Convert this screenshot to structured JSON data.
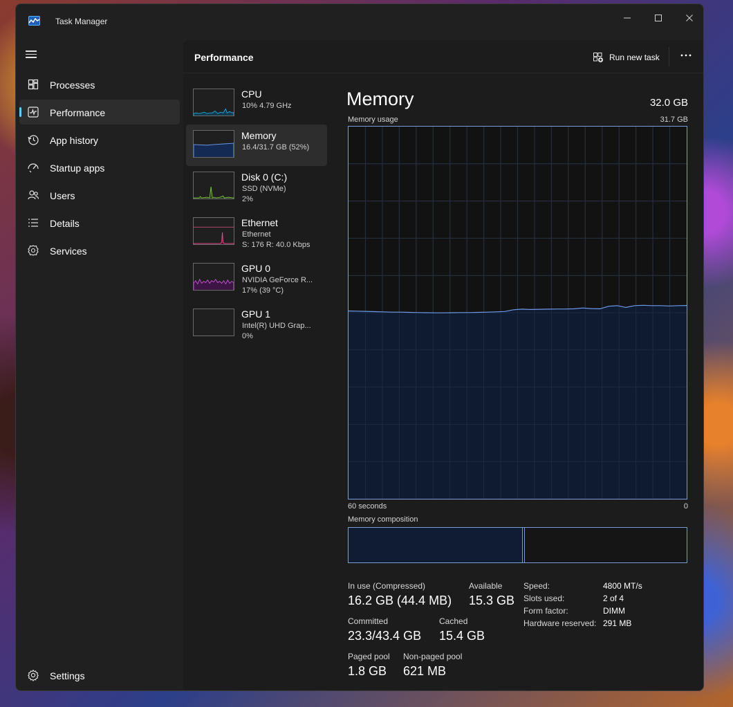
{
  "window": {
    "title": "Task Manager",
    "minimize_icon": "minimize-icon",
    "maximize_icon": "maximize-icon",
    "close_icon": "close-icon"
  },
  "nav": {
    "items": [
      {
        "label": "Processes",
        "icon": "processes-icon"
      },
      {
        "label": "Performance",
        "icon": "performance-icon",
        "active": true
      },
      {
        "label": "App history",
        "icon": "history-icon"
      },
      {
        "label": "Startup apps",
        "icon": "startup-icon"
      },
      {
        "label": "Users",
        "icon": "users-icon"
      },
      {
        "label": "Details",
        "icon": "details-icon"
      },
      {
        "label": "Services",
        "icon": "services-icon"
      }
    ],
    "settings_label": "Settings"
  },
  "header": {
    "title": "Performance",
    "run_new_task": "Run new task"
  },
  "devices": [
    {
      "name": "CPU",
      "line1": "10%  4.79 GHz",
      "line2": "",
      "color": "#17a5d8"
    },
    {
      "name": "Memory",
      "line1": "16.4/31.7 GB (52%)",
      "line2": "",
      "color": "#6f9ae8"
    },
    {
      "name": "Disk 0 (C:)",
      "line1": "SSD (NVMe)",
      "line2": "2%",
      "color": "#7dc142"
    },
    {
      "name": "Ethernet",
      "line1": "Ethernet",
      "line2": "S: 176  R: 40.0 Kbps",
      "color": "#e0508a"
    },
    {
      "name": "GPU 0",
      "line1": "NVIDIA GeForce R...",
      "line2": "17%  (39 °C)",
      "color": "#c04fd0"
    },
    {
      "name": "GPU 1",
      "line1": "Intel(R) UHD Grap...",
      "line2": "0%",
      "color": "#c04fd0"
    }
  ],
  "memory": {
    "title": "Memory",
    "total": "32.0 GB",
    "usage_label": "Memory usage",
    "usage_max": "31.7 GB",
    "axis_left": "60 seconds",
    "axis_right": "0",
    "composition_label": "Memory composition",
    "stats": {
      "in_use_label": "In use (Compressed)",
      "in_use_value": "16.2 GB (44.4 MB)",
      "available_label": "Available",
      "available_value": "15.3 GB",
      "committed_label": "Committed",
      "committed_value": "23.3/43.4 GB",
      "cached_label": "Cached",
      "cached_value": "15.4 GB",
      "paged_label": "Paged pool",
      "paged_value": "1.8 GB",
      "nonpaged_label": "Non-paged pool",
      "nonpaged_value": "621 MB"
    },
    "specs": {
      "speed_label": "Speed:",
      "speed_value": "4800 MT/s",
      "slots_label": "Slots used:",
      "slots_value": "2 of 4",
      "form_label": "Form factor:",
      "form_value": "DIMM",
      "reserved_label": "Hardware reserved:",
      "reserved_value": "291 MB"
    }
  },
  "usage_history_gb": [
    16.0,
    15.98,
    15.96,
    15.94,
    15.92,
    15.9,
    15.9,
    15.88,
    15.86,
    15.85,
    15.84,
    15.84,
    15.85,
    15.86,
    15.86,
    15.88,
    15.9,
    15.92,
    15.95,
    16.1,
    16.15,
    16.12,
    16.14,
    16.15,
    16.16,
    16.16,
    16.18,
    16.25,
    16.2,
    16.18,
    16.4,
    16.45,
    16.3,
    16.45,
    16.48,
    16.45,
    16.45,
    16.42,
    16.45,
    16.46
  ],
  "composition": {
    "in_use_fraction": 0.515,
    "modified_fraction": 0.006
  }
}
